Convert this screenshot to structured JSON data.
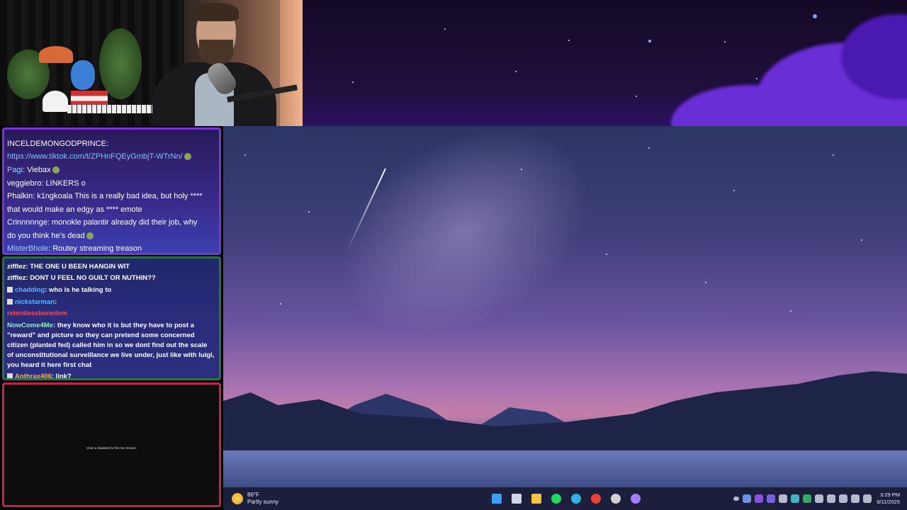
{
  "chat_top": {
    "lines": [
      {
        "user": "INCELDEMONGODPRINCE:",
        "text": ""
      },
      {
        "user": "",
        "text": "https://www.tiktok.com/t/ZPHnFQEyGmbjT-WTrNn/"
      },
      {
        "user": "Pagi",
        "text": ": Viebax"
      },
      {
        "user": "veggiebro",
        "text": ": LINKERS o"
      },
      {
        "user": "Phalkin",
        "text": ": k1ngkoala This is a really bad idea, but holy ****"
      },
      {
        "user": "",
        "text": "that would make an edgy as **** emote"
      },
      {
        "user": "Crinnnnnge",
        "text": ": monokle palantir already did their job, why"
      },
      {
        "user": "",
        "text": "do you think he's dead"
      },
      {
        "user": "MisterBhole",
        "text": ": Routey streaming treason"
      }
    ]
  },
  "chat_mid": {
    "lines": [
      {
        "user": "zifflez",
        "text": ": THE ONE U BEEN HANGIN WIT"
      },
      {
        "user": "zifflez",
        "text": ": DONT U FEEL NO GUILT OR NUTHIN??"
      },
      {
        "user": "chadding",
        "text": ": who is he talking to"
      },
      {
        "user": "nickstarman",
        "text": ":"
      },
      {
        "user": "relentlessboredom",
        "text": ""
      },
      {
        "user": "NowCome4Me",
        "text": ": they know who it is but they have to post a"
      },
      {
        "user": "",
        "text": "\"reward\" and picture so they can pretend some concerned"
      },
      {
        "user": "",
        "text": "citizen (planted fed) called him in so we dont find out the scale"
      },
      {
        "user": "",
        "text": "of unconstitutional surveillance we live under, just like with luigi,"
      },
      {
        "user": "",
        "text": "you heard it here first chat"
      },
      {
        "user": "Anthrax406",
        "text": ": link?"
      }
    ]
  },
  "chat_disabled": {
    "message": "Chat is disabled for this live stream."
  },
  "taskbar": {
    "weather_temp": "86°F",
    "weather_desc": "Partly sunny",
    "time": "3:29 PM",
    "date": "9/11/2025",
    "apps": [
      {
        "name": "start-icon",
        "color": "#3aa0ff"
      },
      {
        "name": "task-view-icon",
        "color": "#cfd6e6"
      },
      {
        "name": "file-explorer-icon",
        "color": "#f5c242"
      },
      {
        "name": "spotify-icon",
        "color": "#1ed760"
      },
      {
        "name": "edge-icon",
        "color": "#2fb3e6"
      },
      {
        "name": "chrome-icon",
        "color": "#e94235"
      },
      {
        "name": "obs-icon",
        "color": "#d0d0d0"
      },
      {
        "name": "app-icon",
        "color": "#a77bff"
      }
    ],
    "tray": [
      {
        "name": "chevron-up-icon",
        "color": "#cfd6e6"
      },
      {
        "name": "bolt-icon",
        "color": "#7aa7ff"
      },
      {
        "name": "purple-app-icon",
        "color": "#9b5bff"
      },
      {
        "name": "stream-deck-icon",
        "color": "#8a6cff"
      },
      {
        "name": "steam-icon",
        "color": "#cfd6e6"
      },
      {
        "name": "circle-app-icon",
        "color": "#46d0d0"
      },
      {
        "name": "color-app-icon",
        "color": "#3ac070"
      },
      {
        "name": "settings-icon",
        "color": "#cfd6e6"
      },
      {
        "name": "drive-icon",
        "color": "#cfd6e6"
      },
      {
        "name": "network-icon",
        "color": "#cfd6e6"
      },
      {
        "name": "display-icon",
        "color": "#cfd6e6"
      },
      {
        "name": "volume-icon",
        "color": "#cfd6e6"
      }
    ]
  }
}
